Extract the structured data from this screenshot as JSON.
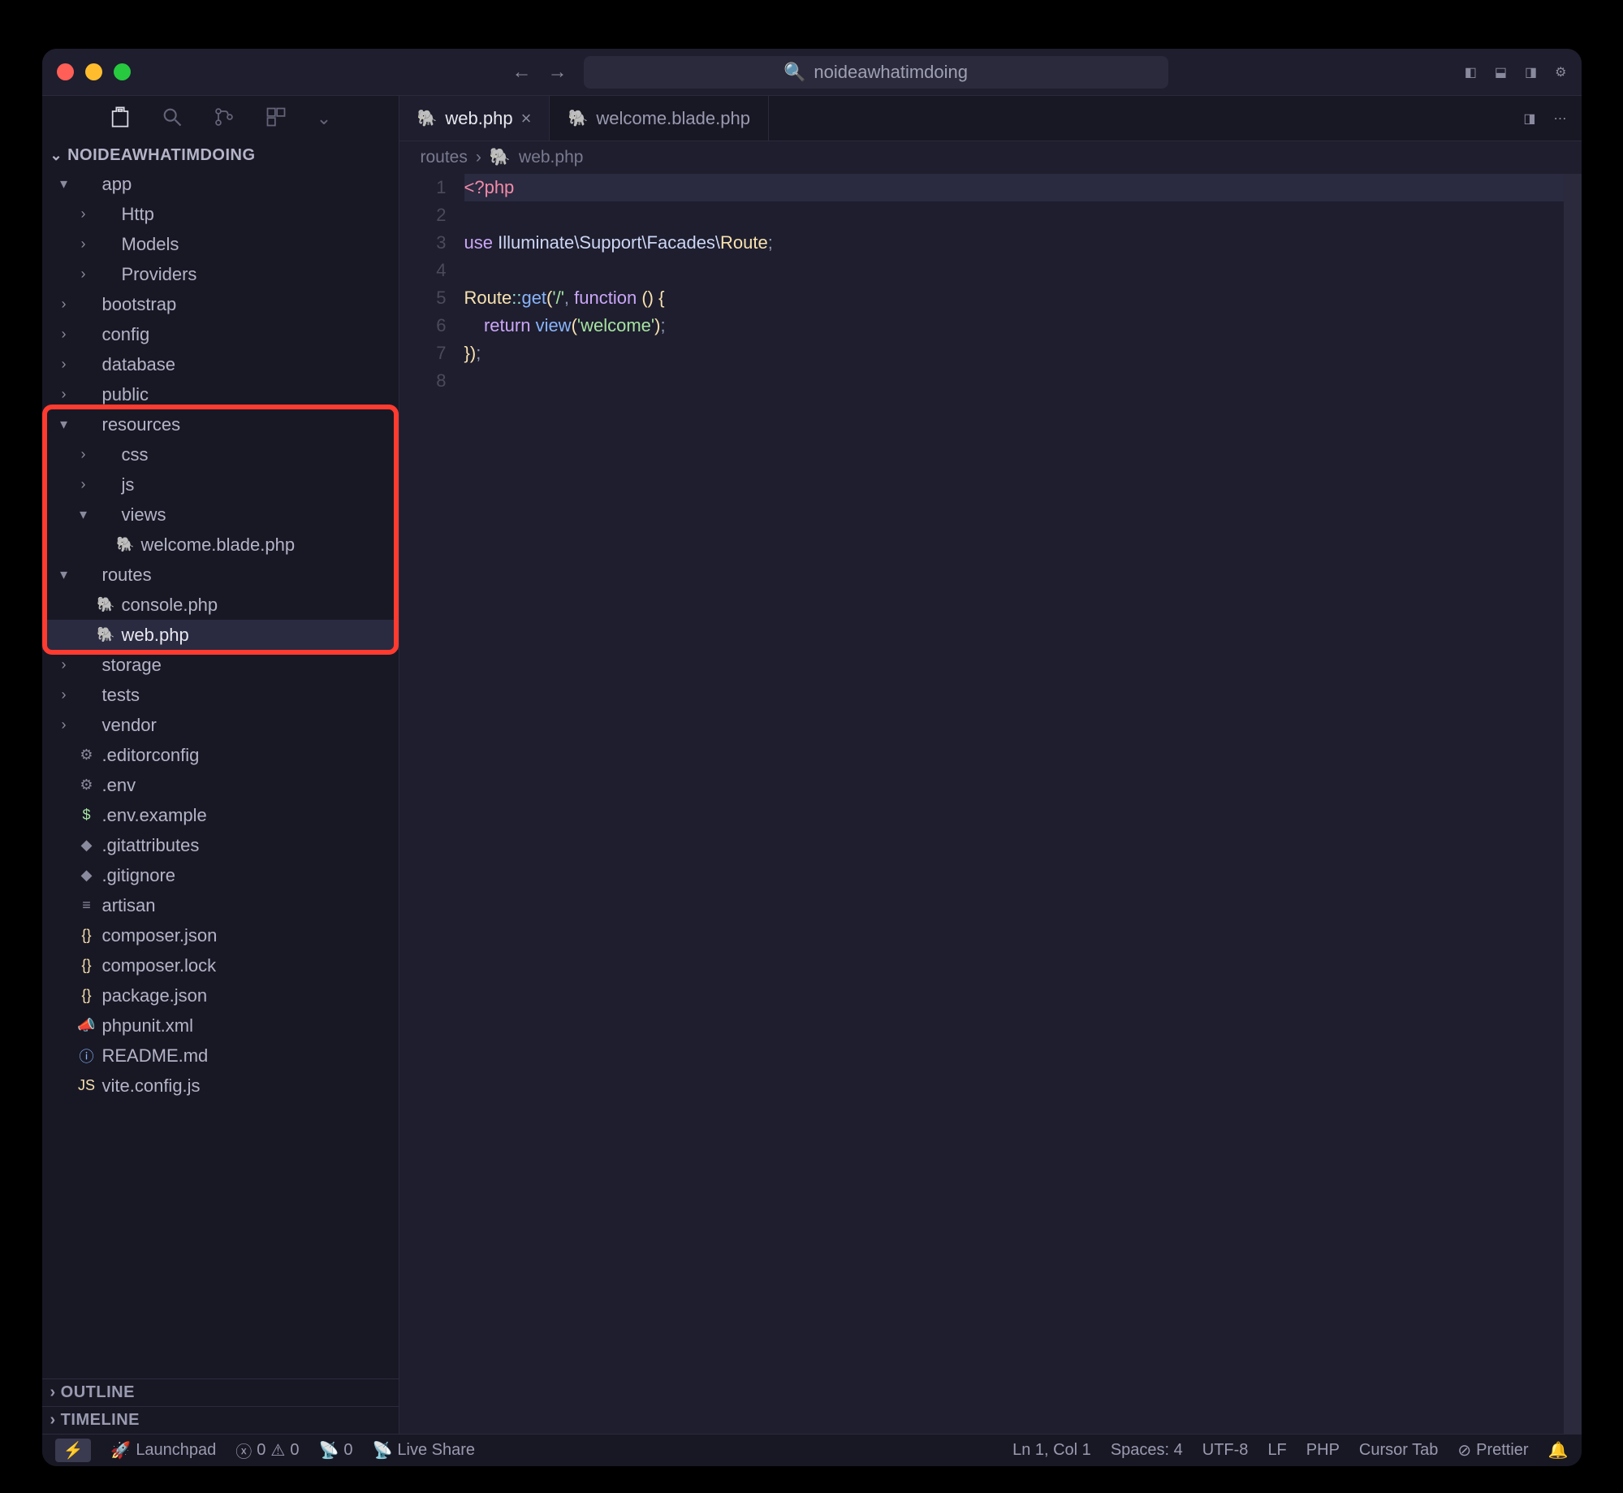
{
  "window": {
    "title": "noideawhatimdoing"
  },
  "project": {
    "name": "NOIDEAWHATIMDOING"
  },
  "tree": [
    {
      "indent": 0,
      "chev": "▾",
      "icon": "",
      "label": "app",
      "type": "folder"
    },
    {
      "indent": 1,
      "chev": "›",
      "icon": "",
      "label": "Http",
      "type": "folder"
    },
    {
      "indent": 1,
      "chev": "›",
      "icon": "",
      "label": "Models",
      "type": "folder"
    },
    {
      "indent": 1,
      "chev": "›",
      "icon": "",
      "label": "Providers",
      "type": "folder"
    },
    {
      "indent": 0,
      "chev": "›",
      "icon": "",
      "label": "bootstrap",
      "type": "folder"
    },
    {
      "indent": 0,
      "chev": "›",
      "icon": "",
      "label": "config",
      "type": "folder"
    },
    {
      "indent": 0,
      "chev": "›",
      "icon": "",
      "label": "database",
      "type": "folder"
    },
    {
      "indent": 0,
      "chev": "›",
      "icon": "",
      "label": "public",
      "type": "folder"
    },
    {
      "indent": 0,
      "chev": "▾",
      "icon": "",
      "label": "resources",
      "type": "folder"
    },
    {
      "indent": 1,
      "chev": "›",
      "icon": "",
      "label": "css",
      "type": "folder"
    },
    {
      "indent": 1,
      "chev": "›",
      "icon": "",
      "label": "js",
      "type": "folder"
    },
    {
      "indent": 1,
      "chev": "▾",
      "icon": "",
      "label": "views",
      "type": "folder"
    },
    {
      "indent": 2,
      "chev": "",
      "icon": "php",
      "label": "welcome.blade.php",
      "type": "file"
    },
    {
      "indent": 0,
      "chev": "▾",
      "icon": "",
      "label": "routes",
      "type": "folder"
    },
    {
      "indent": 1,
      "chev": "",
      "icon": "php",
      "label": "console.php",
      "type": "file"
    },
    {
      "indent": 1,
      "chev": "",
      "icon": "php",
      "label": "web.php",
      "type": "file",
      "selected": true
    },
    {
      "indent": 0,
      "chev": "›",
      "icon": "",
      "label": "storage",
      "type": "folder"
    },
    {
      "indent": 0,
      "chev": "›",
      "icon": "",
      "label": "tests",
      "type": "folder"
    },
    {
      "indent": 0,
      "chev": "›",
      "icon": "",
      "label": "vendor",
      "type": "folder"
    },
    {
      "indent": 0,
      "chev": "",
      "icon": "gear",
      "label": ".editorconfig",
      "type": "file"
    },
    {
      "indent": 0,
      "chev": "",
      "icon": "gear",
      "label": ".env",
      "type": "file"
    },
    {
      "indent": 0,
      "chev": "",
      "icon": "dollar",
      "label": ".env.example",
      "type": "file"
    },
    {
      "indent": 0,
      "chev": "",
      "icon": "git",
      "label": ".gitattributes",
      "type": "file"
    },
    {
      "indent": 0,
      "chev": "",
      "icon": "git",
      "label": ".gitignore",
      "type": "file"
    },
    {
      "indent": 0,
      "chev": "",
      "icon": "lines",
      "label": "artisan",
      "type": "file"
    },
    {
      "indent": 0,
      "chev": "",
      "icon": "json",
      "label": "composer.json",
      "type": "file"
    },
    {
      "indent": 0,
      "chev": "",
      "icon": "json",
      "label": "composer.lock",
      "type": "file"
    },
    {
      "indent": 0,
      "chev": "",
      "icon": "json",
      "label": "package.json",
      "type": "file"
    },
    {
      "indent": 0,
      "chev": "",
      "icon": "xml",
      "label": "phpunit.xml",
      "type": "file"
    },
    {
      "indent": 0,
      "chev": "",
      "icon": "info",
      "label": "README.md",
      "type": "file"
    },
    {
      "indent": 0,
      "chev": "",
      "icon": "js",
      "label": "vite.config.js",
      "type": "file"
    }
  ],
  "highlight": {
    "startRow": 8,
    "endRow": 15
  },
  "panels": {
    "outline": "OUTLINE",
    "timeline": "TIMELINE"
  },
  "tabs": [
    {
      "icon": "php",
      "label": "web.php",
      "active": true,
      "closable": true
    },
    {
      "icon": "php",
      "label": "welcome.blade.php",
      "active": false,
      "closable": false
    }
  ],
  "breadcrumb": {
    "folder": "routes",
    "icon": "php",
    "file": "web.php"
  },
  "code": {
    "lines": [
      {
        "n": 1,
        "hl": true,
        "html": "<span class='tk-tag'>&lt;?php</span>"
      },
      {
        "n": 2,
        "hl": false,
        "html": ""
      },
      {
        "n": 3,
        "hl": false,
        "html": "<span class='tk-kw'>use</span> <span class='tk-ns'>Illuminate\\Support\\Facades\\</span><span class='tk-cls'>Route</span><span class='tk-punc'>;</span>"
      },
      {
        "n": 4,
        "hl": false,
        "html": ""
      },
      {
        "n": 5,
        "hl": false,
        "html": "<span class='tk-cls'>Route</span><span class='tk-op'>::</span><span class='tk-fn'>get</span><span class='tk-bracket'>(</span><span class='tk-str'>'/'</span><span class='tk-punc'>,</span> <span class='tk-kw'>function</span> <span class='tk-bracket'>()</span> <span class='tk-bracket'>{</span>"
      },
      {
        "n": 6,
        "hl": false,
        "html": "    <span class='tk-kw'>return</span> <span class='tk-fn'>view</span><span class='tk-bracket'>(</span><span class='tk-str'>'welcome'</span><span class='tk-bracket'>)</span><span class='tk-punc'>;</span>"
      },
      {
        "n": 7,
        "hl": false,
        "html": "<span class='tk-bracket'>})</span><span class='tk-punc'>;</span>"
      },
      {
        "n": 8,
        "hl": false,
        "html": ""
      }
    ]
  },
  "status": {
    "launchpad": "Launchpad",
    "errors": "0",
    "warnings": "0",
    "ports": "0",
    "liveshare": "Live Share",
    "position": "Ln 1, Col 1",
    "spaces": "Spaces: 4",
    "encoding": "UTF-8",
    "eol": "LF",
    "lang": "PHP",
    "cursor": "Cursor Tab",
    "prettier": "Prettier"
  },
  "icons": {
    "php": "🐘",
    "gear": "⚙",
    "dollar": "$",
    "git": "◆",
    "lines": "≡",
    "json": "{}",
    "xml": "📣",
    "info": "ⓘ",
    "js": "JS"
  },
  "iconColors": {
    "php": "#a074c4",
    "gear": "#8a8a9e",
    "dollar": "#a6e3a1",
    "git": "#8a8a9e",
    "lines": "#8a8a9e",
    "json": "#f9e2af",
    "xml": "#f38ba8",
    "info": "#89b4fa",
    "js": "#f9e2af"
  }
}
